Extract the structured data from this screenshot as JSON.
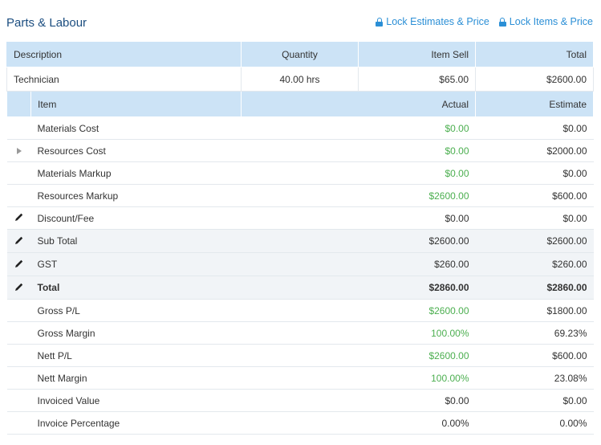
{
  "header": {
    "title": "Parts & Labour",
    "lock_estimates_label": "Lock Estimates & Price",
    "lock_items_label": "Lock Items & Price"
  },
  "labour_table": {
    "columns": [
      "Description",
      "Quantity",
      "Item Sell",
      "Total"
    ],
    "rows": [
      {
        "description": "Technician",
        "quantity": "40.00 hrs",
        "item_sell": "$65.00",
        "total": "$2600.00"
      }
    ]
  },
  "summary_table": {
    "columns": [
      "Item",
      "Actual",
      "Estimate"
    ],
    "rows": [
      {
        "item": "Materials Cost",
        "actual": "$0.00",
        "estimate": "$0.00"
      },
      {
        "item": "Resources Cost",
        "actual": "$0.00",
        "estimate": "$2000.00"
      },
      {
        "item": "Materials Markup",
        "actual": "$0.00",
        "estimate": "$0.00"
      },
      {
        "item": "Resources Markup",
        "actual": "$2600.00",
        "estimate": "$600.00"
      },
      {
        "item": "Discount/Fee",
        "actual": "$0.00",
        "estimate": "$0.00"
      },
      {
        "item": "Sub Total",
        "actual": "$2600.00",
        "estimate": "$2600.00"
      },
      {
        "item": "GST",
        "actual": "$260.00",
        "estimate": "$260.00"
      },
      {
        "item": "Total",
        "actual": "$2860.00",
        "estimate": "$2860.00"
      },
      {
        "item": "Gross P/L",
        "actual": "$2600.00",
        "estimate": "$1800.00"
      },
      {
        "item": "Gross Margin",
        "actual": "100.00%",
        "estimate": "69.23%"
      },
      {
        "item": "Nett P/L",
        "actual": "$2600.00",
        "estimate": "$600.00"
      },
      {
        "item": "Nett Margin",
        "actual": "100.00%",
        "estimate": "23.08%"
      },
      {
        "item": "Invoiced Value",
        "actual": "$0.00",
        "estimate": "$0.00"
      },
      {
        "item": "Invoice Percentage",
        "actual": "0.00%",
        "estimate": "0.00%"
      }
    ]
  },
  "colors": {
    "positive": "#4caf50",
    "header_bg": "#cce3f6",
    "title": "#1c4e80",
    "link": "#2b8fd6"
  }
}
